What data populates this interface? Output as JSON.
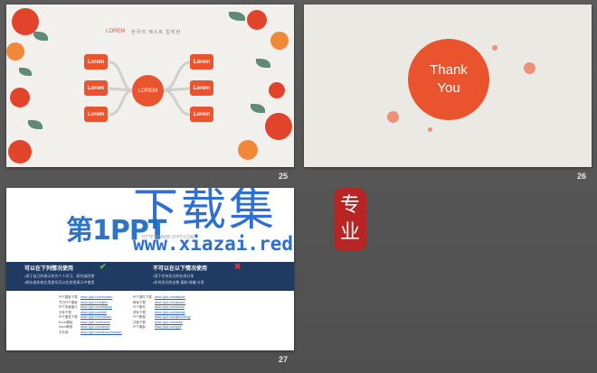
{
  "slides": [
    {
      "number": "25",
      "header_label": "LOREM",
      "header_text": "한국어 텍스트 입력란",
      "center_label": "LOREM",
      "boxes": [
        "Lorem",
        "Lorem",
        "Lorem",
        "Lorem",
        "Lorem",
        "Lorem"
      ]
    },
    {
      "number": "26",
      "title_line1": "Thank",
      "title_line2": "You"
    },
    {
      "number": "27",
      "logo_text": "第1PPT",
      "logo_url": "HTTP://WWW.1PPT.COM",
      "allowed_heading": "可以在下列情况使用",
      "allowed_items": [
        "•用于自己的演示作为个人学习、研究或欣赏",
        "•商业或非商业用途均可以在其他演示中使用"
      ],
      "disallowed_heading": "不可以在以下情况使用",
      "disallowed_items": [
        "•用于任何形式的在线分享",
        "•任何形式的出售 复制 改编 分发"
      ],
      "links_left": [
        "www.1ppt.com/moban/",
        "www.1ppt.com/jieri/",
        "www.1ppt.com/beijing/",
        "www.1ppt.com/ziti/",
        "www.1ppt.com/tubiao/",
        "www.1ppt.com/excel/",
        "www.1ppt.com/word/",
        "www.1ppt.com/shouchaobao/"
      ],
      "labels_left": [
        "PPT模板下载",
        "节日PPT模板",
        "PPT背景图片",
        "字体下载",
        "PPT图表下载",
        "Excel模板",
        "Word教程",
        "手抄报"
      ],
      "links_right": [
        "www.1ppt.com/kejian/",
        "www.1ppt.com/jiaoan/",
        "www.1ppt.com/sucai/",
        "www.1ppt.com/xiazai/",
        "www.1ppt.com/jiaocheng/",
        "www.1ppt.com/shiti/",
        "www.1ppt.com/ppt/"
      ],
      "labels_right": [
        "PPT课件下载",
        "教案下载",
        "PPT素材",
        "资料下载",
        "PPT教程",
        "试卷下载",
        "PPT模板"
      ]
    }
  ],
  "watermark": {
    "title": "下载集",
    "url": "www.xiazai.red",
    "seal": [
      "专",
      "业"
    ]
  },
  "colors": {
    "accent": "#e9532e",
    "background": "#5a5a5a",
    "watermark": "#1c63d0",
    "seal": "#b72525"
  }
}
